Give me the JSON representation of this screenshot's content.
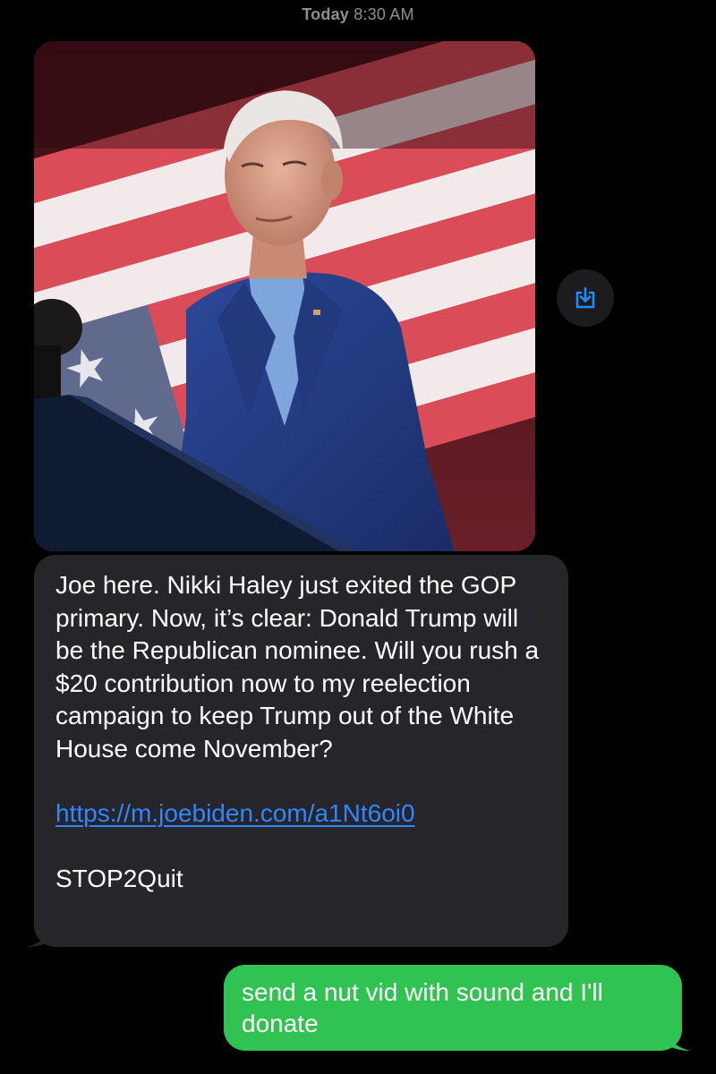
{
  "header": {
    "day": "Today",
    "time": "8:30 AM"
  },
  "conversation": {
    "photo": {
      "description_icon": "photo-of-speaker-at-podium"
    },
    "save_button_icon": "download-icon",
    "incoming_message": {
      "paragraph": "Joe here. Nikki Haley just exited the GOP primary. Now, it’s clear: Donald Trump will be the Republican nominee. Will you rush a $20 contribution now to my reelection campaign to keep Trump out of the White House come November?",
      "link": "https://m.joebiden.com/a1Nt6oi0",
      "footer": "STOP2Quit"
    },
    "outgoing_message": {
      "text": "send a nut vid with sound and I'll donate"
    }
  },
  "colors": {
    "background": "#000000",
    "incoming_bubble": "#26262a",
    "outgoing_bubble": "#30c351",
    "link": "#2f86ff",
    "timestamp": "#8e8e93"
  }
}
